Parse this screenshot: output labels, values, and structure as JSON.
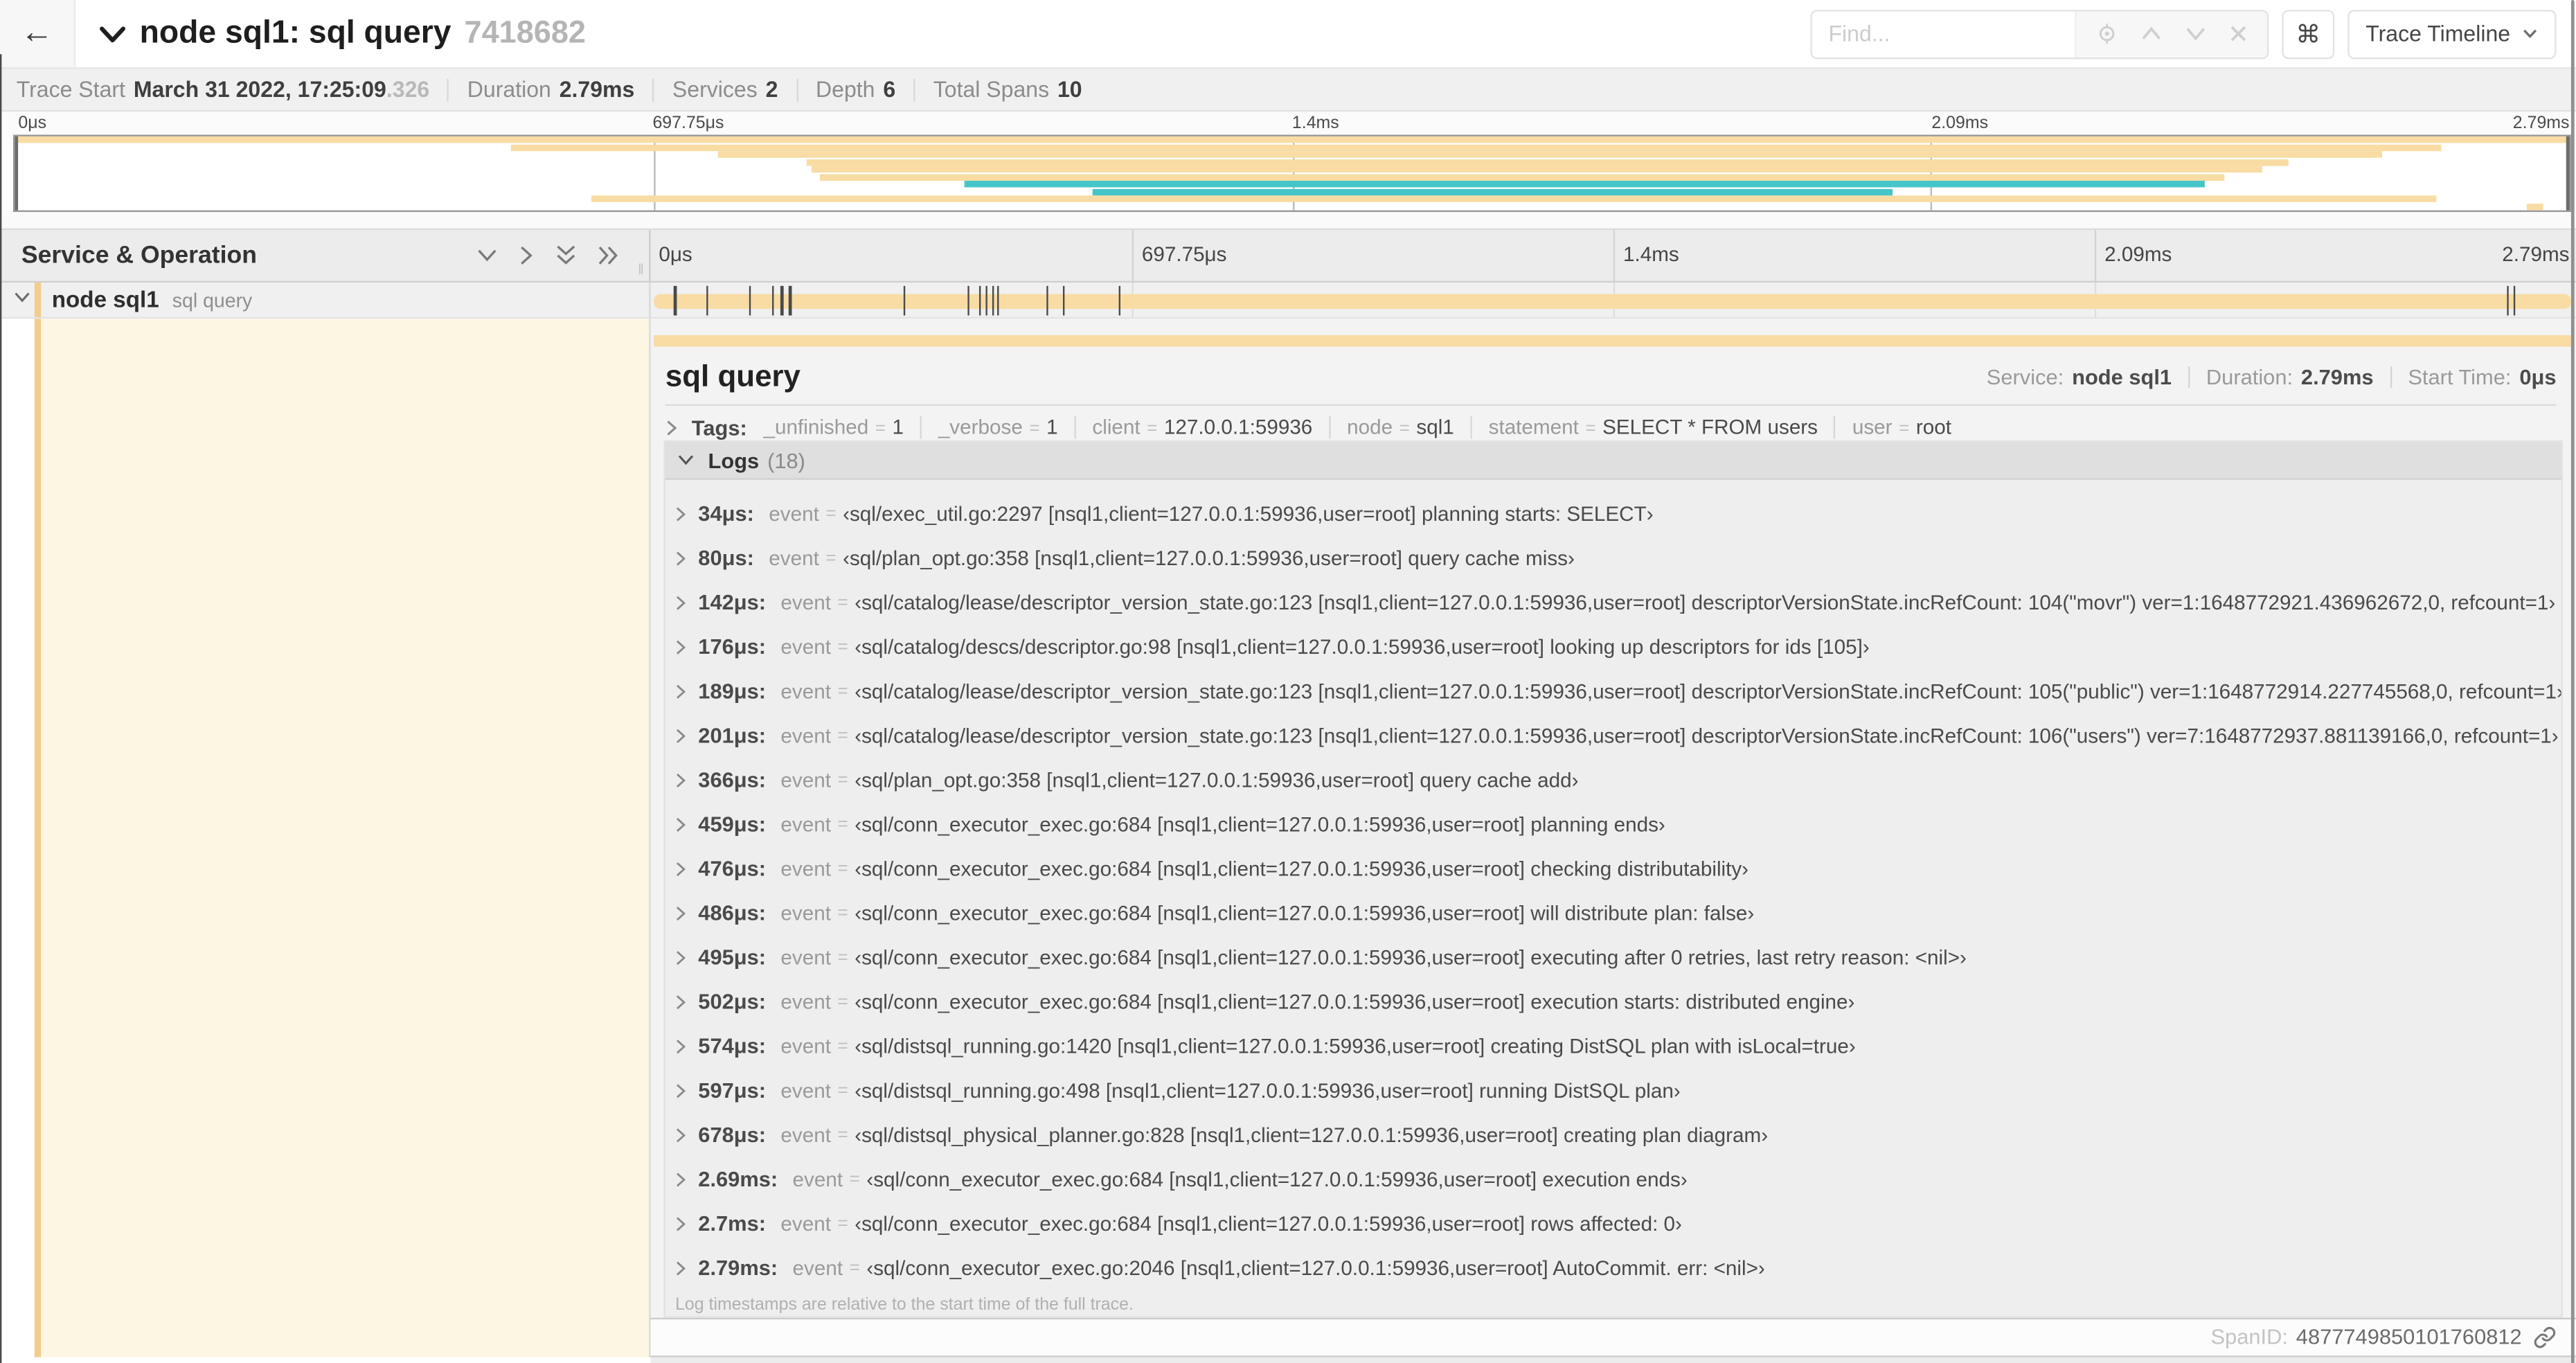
{
  "header": {
    "title": "node sql1: sql query",
    "trace_id": "7418682",
    "find_placeholder": "Find...",
    "view_selector": "Trace Timeline"
  },
  "summary": {
    "trace_start_label": "Trace Start",
    "trace_start": "March 31 2022, 17:25:09",
    "trace_start_ms": ".326",
    "duration_label": "Duration",
    "duration": "2.79ms",
    "services_label": "Services",
    "services": "2",
    "depth_label": "Depth",
    "depth": "6",
    "total_spans_label": "Total Spans",
    "total_spans": "10"
  },
  "ticks": [
    "0μs",
    "697.75μs",
    "1.4ms",
    "2.09ms",
    "2.79ms"
  ],
  "left_panel": {
    "title": "Service & Operation"
  },
  "span": {
    "service": "node sql1",
    "operation": "sql query"
  },
  "chart_data": {
    "type": "table",
    "title": "trace minimap span rows (percent of 2.79ms trace)",
    "minimap_rows": [
      {
        "start": 0,
        "end": 100,
        "color": "orange"
      },
      {
        "start": 19.4,
        "end": 95,
        "color": "orange"
      },
      {
        "start": 27.5,
        "end": 92.7,
        "color": "orange"
      },
      {
        "start": 31,
        "end": 89,
        "color": "orange"
      },
      {
        "start": 31.2,
        "end": 88,
        "color": "orange"
      },
      {
        "start": 31.5,
        "end": 86.5,
        "color": "orange"
      },
      {
        "start": 37.2,
        "end": 85.7,
        "color": "teal"
      },
      {
        "start": 42.2,
        "end": 73.5,
        "color": "teal"
      },
      {
        "start": 22.6,
        "end": 94.8,
        "color": "orange"
      },
      {
        "start": 98.3,
        "end": 99,
        "color": "orange"
      }
    ],
    "trace_total_us": 2790
  },
  "colors": {
    "orange": "#f8dca4",
    "teal": "#45c5c8",
    "cream": "#fdf6e3",
    "stripe": "#f3cd8d"
  },
  "detail": {
    "title": "sql query",
    "service_label": "Service:",
    "service": "node sql1",
    "duration_label": "Duration:",
    "duration": "2.79ms",
    "start_label": "Start Time:",
    "start": "0μs",
    "tags_label": "Tags:",
    "tags": [
      {
        "key": "_unfinished",
        "value": "1"
      },
      {
        "key": "_verbose",
        "value": "1"
      },
      {
        "key": "client",
        "value": "127.0.0.1:59936"
      },
      {
        "key": "node",
        "value": "sql1"
      },
      {
        "key": "statement",
        "value": "SELECT * FROM users"
      },
      {
        "key": "user",
        "value": "root"
      }
    ],
    "logs_label": "Logs",
    "logs_count": "(18)",
    "logs": [
      {
        "t": "34μs:",
        "t_us": 34,
        "key": "event",
        "value": "sql/exec_util.go:2297 [nsql1,client=127.0.0.1:59936,user=root] planning starts: SELECT"
      },
      {
        "t": "80μs:",
        "t_us": 80,
        "key": "event",
        "value": "sql/plan_opt.go:358 [nsql1,client=127.0.0.1:59936,user=root] query cache miss"
      },
      {
        "t": "142μs:",
        "t_us": 142,
        "key": "event",
        "value": "sql/catalog/lease/descriptor_version_state.go:123 [nsql1,client=127.0.0.1:59936,user=root] descriptorVersionState.incRefCount: 104(\"movr\") ver=1:1648772921.436962672,0, refcount=1"
      },
      {
        "t": "176μs:",
        "t_us": 176,
        "key": "event",
        "value": "sql/catalog/descs/descriptor.go:98 [nsql1,client=127.0.0.1:59936,user=root] looking up descriptors for ids [105]"
      },
      {
        "t": "189μs:",
        "t_us": 189,
        "key": "event",
        "value": "sql/catalog/lease/descriptor_version_state.go:123 [nsql1,client=127.0.0.1:59936,user=root] descriptorVersionState.incRefCount: 105(\"public\") ver=1:1648772914.227745568,0, refcount=1"
      },
      {
        "t": "201μs:",
        "t_us": 201,
        "key": "event",
        "value": "sql/catalog/lease/descriptor_version_state.go:123 [nsql1,client=127.0.0.1:59936,user=root] descriptorVersionState.incRefCount: 106(\"users\") ver=7:1648772937.881139166,0, refcount=1"
      },
      {
        "t": "366μs:",
        "t_us": 366,
        "key": "event",
        "value": "sql/plan_opt.go:358 [nsql1,client=127.0.0.1:59936,user=root] query cache add"
      },
      {
        "t": "459μs:",
        "t_us": 459,
        "key": "event",
        "value": "sql/conn_executor_exec.go:684 [nsql1,client=127.0.0.1:59936,user=root] planning ends"
      },
      {
        "t": "476μs:",
        "t_us": 476,
        "key": "event",
        "value": "sql/conn_executor_exec.go:684 [nsql1,client=127.0.0.1:59936,user=root] checking distributability"
      },
      {
        "t": "486μs:",
        "t_us": 486,
        "key": "event",
        "value": "sql/conn_executor_exec.go:684 [nsql1,client=127.0.0.1:59936,user=root] will distribute plan: false"
      },
      {
        "t": "495μs:",
        "t_us": 495,
        "key": "event",
        "value": "sql/conn_executor_exec.go:684 [nsql1,client=127.0.0.1:59936,user=root] executing after 0 retries, last retry reason: <nil>"
      },
      {
        "t": "502μs:",
        "t_us": 502,
        "key": "event",
        "value": "sql/conn_executor_exec.go:684 [nsql1,client=127.0.0.1:59936,user=root] execution starts: distributed engine"
      },
      {
        "t": "574μs:",
        "t_us": 574,
        "key": "event",
        "value": "sql/distsql_running.go:1420 [nsql1,client=127.0.0.1:59936,user=root] creating DistSQL plan with isLocal=true"
      },
      {
        "t": "597μs:",
        "t_us": 597,
        "key": "event",
        "value": "sql/distsql_running.go:498 [nsql1,client=127.0.0.1:59936,user=root] running DistSQL plan"
      },
      {
        "t": "678μs:",
        "t_us": 678,
        "key": "event",
        "value": "sql/distsql_physical_planner.go:828 [nsql1,client=127.0.0.1:59936,user=root] creating plan diagram"
      },
      {
        "t": "2.69ms:",
        "t_us": 2690,
        "key": "event",
        "value": "sql/conn_executor_exec.go:684 [nsql1,client=127.0.0.1:59936,user=root] execution ends"
      },
      {
        "t": "2.7ms:",
        "t_us": 2700,
        "key": "event",
        "value": "sql/conn_executor_exec.go:684 [nsql1,client=127.0.0.1:59936,user=root] rows affected: 0"
      },
      {
        "t": "2.79ms:",
        "t_us": 2790,
        "key": "event",
        "value": "sql/conn_executor_exec.go:2046 [nsql1,client=127.0.0.1:59936,user=root] AutoCommit. err: <nil>"
      }
    ],
    "footer_note": "Log timestamps are relative to the start time of the full trace.",
    "spanid_label": "SpanID:",
    "spanid": "4877749850101760812"
  }
}
